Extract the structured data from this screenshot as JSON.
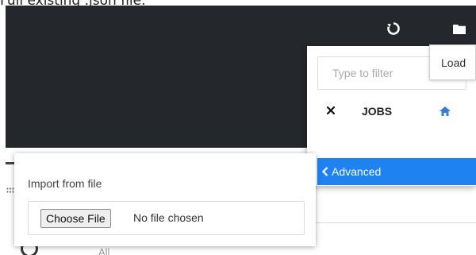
{
  "caption": {
    "text": "Full existing .json file."
  },
  "header": {
    "refresh_icon": "refresh-icon",
    "folder_icon": "folder-icon"
  },
  "dropdown": {
    "filter_placeholder": "Type to filter",
    "filter_value": "",
    "items": [
      {
        "label": "JOBS",
        "remove_icon": "close-icon",
        "home_icon": "home-icon"
      }
    ],
    "advanced_label": "Advanced",
    "advanced_icon": "chevron-left-icon"
  },
  "tooltip": {
    "label": "Load"
  },
  "import": {
    "title": "Import from file",
    "choose_button": "Choose File",
    "status": "No file chosen"
  },
  "background": {
    "filter_option": "All"
  },
  "colors": {
    "header_bg": "#24272b",
    "accent": "#1e82f0",
    "home_icon": "#3a7bd5"
  }
}
